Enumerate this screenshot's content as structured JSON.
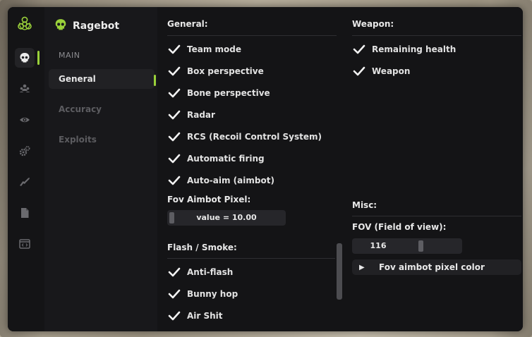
{
  "app": {
    "title": "Ragebot",
    "brand_icon": "skull-icon",
    "accent_color": "#9ad13a"
  },
  "iconbar": {
    "items": [
      {
        "name": "biohazard-logo-icon",
        "active": false
      },
      {
        "name": "skull-icon",
        "active": true
      },
      {
        "name": "players-icon",
        "active": false
      },
      {
        "name": "eye-icon",
        "active": false
      },
      {
        "name": "gears-icon",
        "active": false
      },
      {
        "name": "rifle-icon",
        "active": false
      },
      {
        "name": "file-icon",
        "active": false
      },
      {
        "name": "code-window-icon",
        "active": false
      }
    ]
  },
  "menu": {
    "section": "MAIN",
    "items": [
      {
        "label": "General",
        "active": true
      },
      {
        "label": "Accuracy",
        "active": false
      },
      {
        "label": "Exploits",
        "active": false
      }
    ]
  },
  "general": {
    "title": "General:",
    "checks": [
      {
        "label": "Team mode",
        "checked": true
      },
      {
        "label": "Box perspective",
        "checked": true
      },
      {
        "label": "Bone perspective",
        "checked": true
      },
      {
        "label": "Radar",
        "checked": true
      },
      {
        "label": "RCS (Recoil Control System)",
        "checked": true
      },
      {
        "label": "Automatic firing",
        "checked": true
      },
      {
        "label": "Auto-aim (aimbot)",
        "checked": true
      }
    ],
    "fov_label": "Fov Aimbot Pixel:",
    "fov_value_text": "value = 10.00",
    "fov_value": 10.0
  },
  "flash": {
    "title": "Flash / Smoke:",
    "checks": [
      {
        "label": "Anti-flash",
        "checked": true
      },
      {
        "label": "Bunny hop",
        "checked": true
      },
      {
        "label": "Air Shit",
        "checked": true
      }
    ]
  },
  "weapon": {
    "title": "Weapon:",
    "checks": [
      {
        "label": "Remaining health",
        "checked": true
      },
      {
        "label": "Weapon",
        "checked": true
      }
    ]
  },
  "misc": {
    "title": "Misc:",
    "fov_label": "FOV (Field of view):",
    "fov_value_text": "116",
    "fov_value": 116,
    "color_button_label": "Fov aimbot pixel color",
    "color_button_arrow": "▶"
  }
}
